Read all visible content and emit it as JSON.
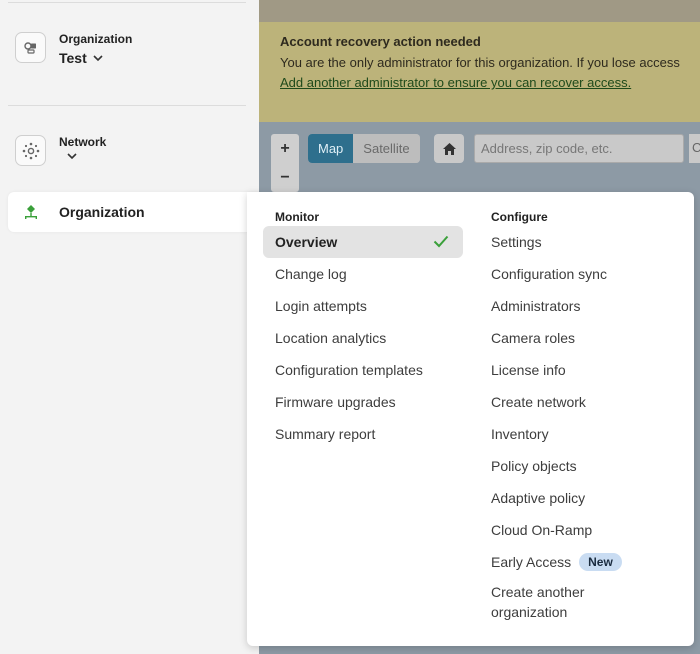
{
  "sidebar": {
    "org_label": "Organization",
    "org_value": "Test",
    "network_label": "Network",
    "network_value": "",
    "active_item": "Organization"
  },
  "banner": {
    "title": "Account recovery action needed",
    "text": "You are the only administrator for this organization. If you lose access",
    "link": "Add another administrator to ensure you can recover access."
  },
  "map": {
    "zoom_in": "+",
    "zoom_out": "−",
    "map_button": "Map",
    "satellite_button": "Satellite",
    "address_placeholder": "Address, zip code, etc.",
    "extra_text": "C"
  },
  "menu": {
    "monitor_heading": "Monitor",
    "monitor_items": [
      "Overview",
      "Change log",
      "Login attempts",
      "Location analytics",
      "Configuration templates",
      "Firmware upgrades",
      "Summary report"
    ],
    "selected": "Overview",
    "configure_heading": "Configure",
    "configure_items": [
      "Settings",
      "Configuration sync",
      "Administrators",
      "Camera roles",
      "License info",
      "Create network",
      "Inventory",
      "Policy objects",
      "Adaptive policy",
      "Cloud On-Ramp",
      "Early Access",
      "Create another organization"
    ],
    "early_access_badge": "New"
  },
  "colors": {
    "accent_green": "#3aa03a",
    "badge_bg": "#c9dcf2",
    "selected_bg": "#e3e3e3"
  },
  "icons": [
    "organization-icon",
    "network-icon",
    "org-tree-icon",
    "check-icon",
    "chevron-down-icon",
    "home-icon"
  ]
}
